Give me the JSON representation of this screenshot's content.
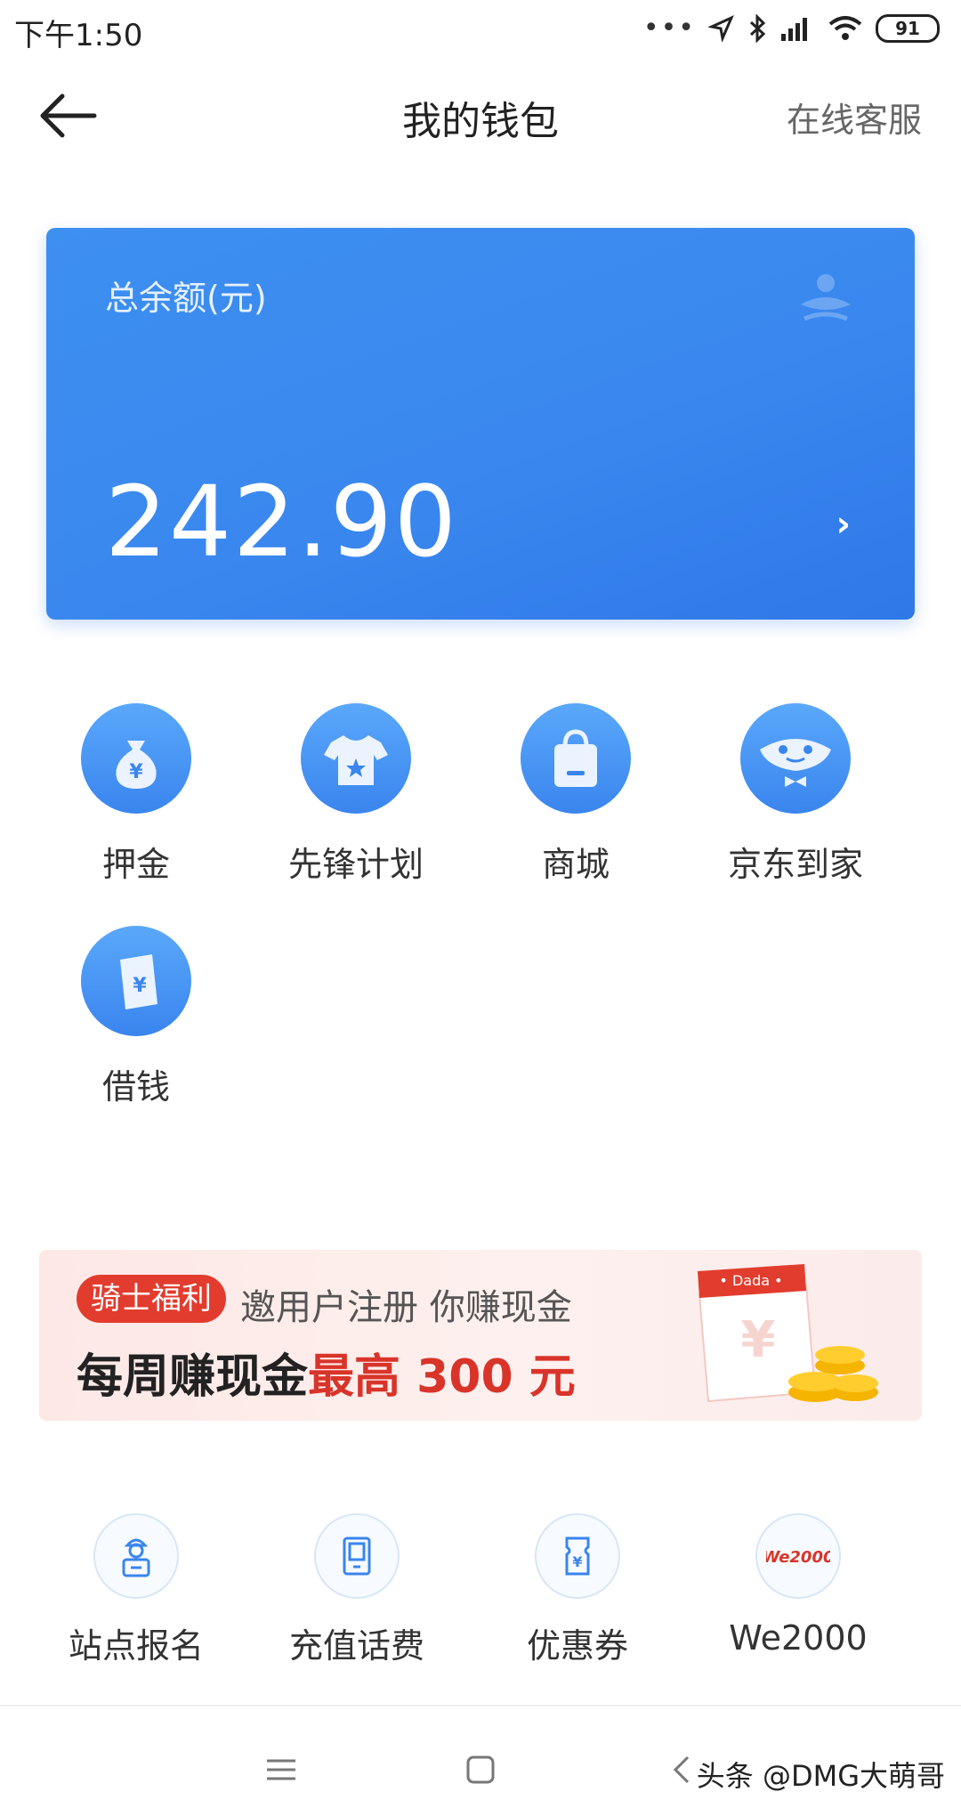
{
  "status_bar": {
    "time": "下午1:50",
    "battery": "91"
  },
  "nav": {
    "title": "我的钱包",
    "service": "在线客服"
  },
  "balance": {
    "label": "总余额(元)",
    "amount": "242.90"
  },
  "grid": [
    {
      "label": "押金",
      "icon": "money-bag-icon"
    },
    {
      "label": "先锋计划",
      "icon": "tshirt-star-icon"
    },
    {
      "label": "商城",
      "icon": "shopping-bag-icon"
    },
    {
      "label": "京东到家",
      "icon": "jd-mascot-icon"
    },
    {
      "label": "借钱",
      "icon": "loan-note-icon"
    }
  ],
  "banner": {
    "tag": "骑士福利",
    "subtitle": "邀用户注册 你赚现金",
    "main_prefix": "每周赚现金",
    "main_highlight": "最高 300 元",
    "calendar_label": "• Dada •"
  },
  "tools": [
    {
      "label": "站点报名",
      "icon": "courier-icon"
    },
    {
      "label": "充值话费",
      "icon": "phone-icon"
    },
    {
      "label": "优惠券",
      "icon": "coupon-icon"
    },
    {
      "label": "We2000",
      "icon": "we2000-logo-icon",
      "logo_text": "We2000"
    }
  ],
  "watermark": "头条 @DMG大萌哥",
  "colors": {
    "primary": "#3a88ef",
    "banner_red": "#e23c2e"
  }
}
